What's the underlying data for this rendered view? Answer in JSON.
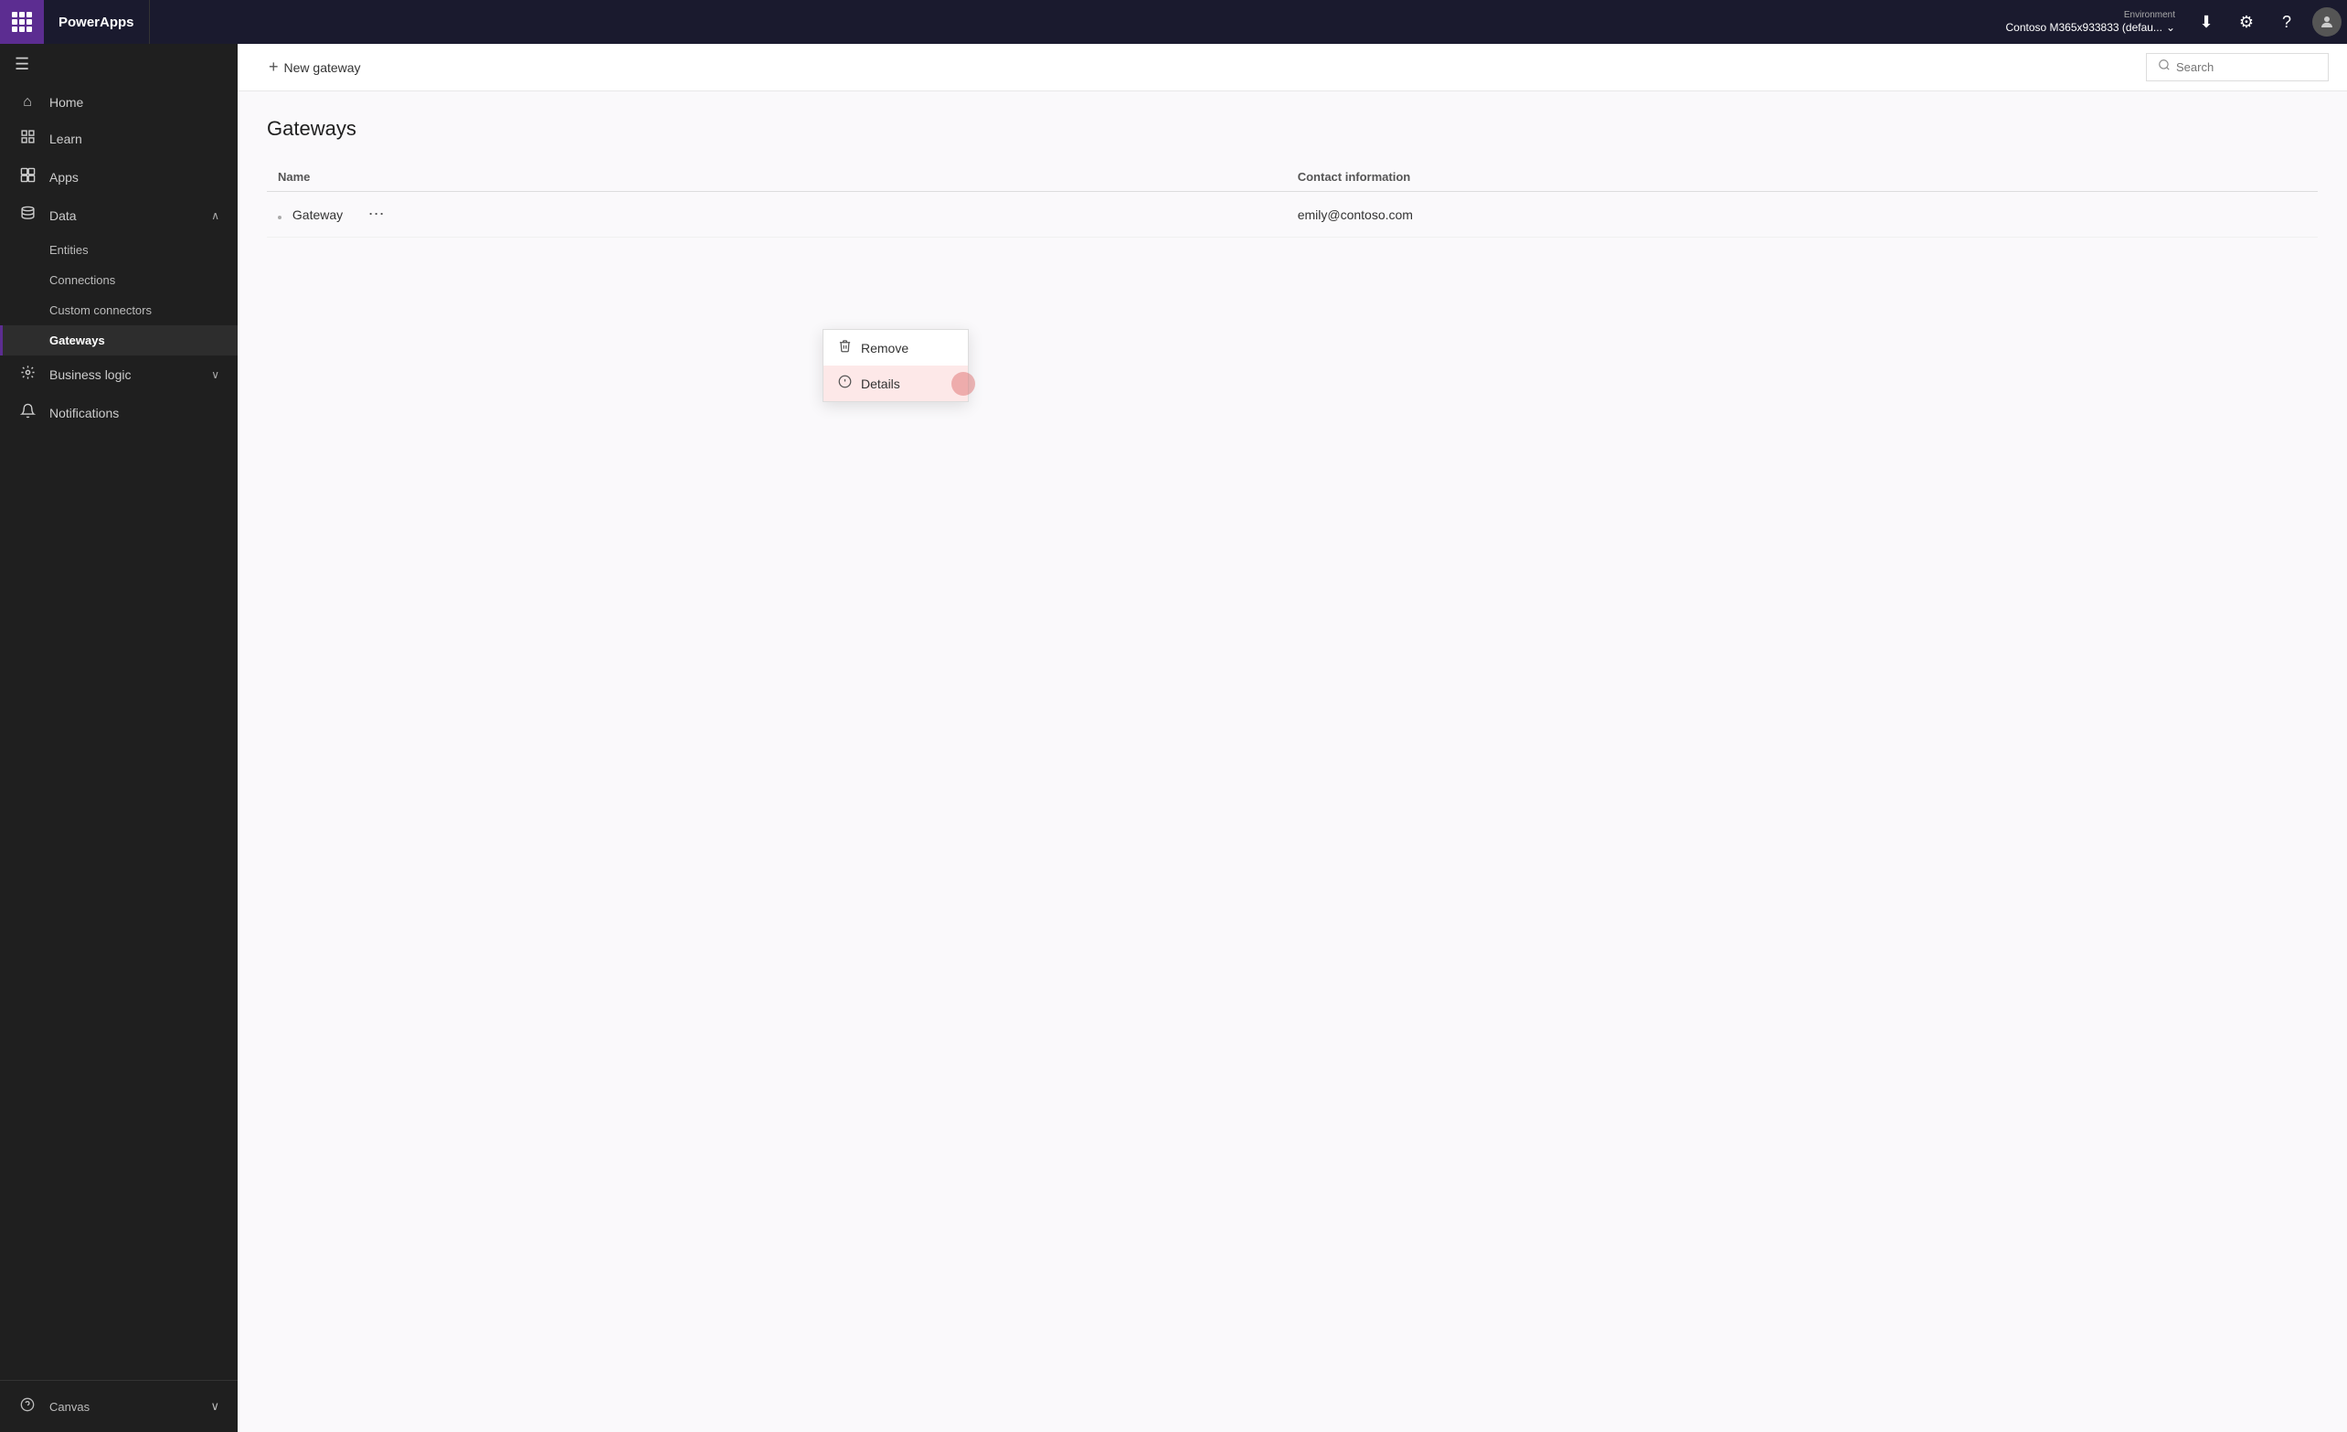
{
  "topbar": {
    "brand": "PowerApps",
    "environment_label": "Environment",
    "environment_name": "Contoso M365x933833 (defau...",
    "download_icon": "⬇",
    "settings_icon": "⚙",
    "help_icon": "?",
    "avatar_letter": ""
  },
  "sidebar": {
    "collapse_label": "☰",
    "items": [
      {
        "id": "home",
        "label": "Home",
        "icon": "⌂",
        "active": false
      },
      {
        "id": "learn",
        "label": "Learn",
        "icon": "📚",
        "active": false
      },
      {
        "id": "apps",
        "label": "Apps",
        "icon": "⊞",
        "active": false
      },
      {
        "id": "data",
        "label": "Data",
        "icon": "⊟",
        "active": false,
        "expanded": true
      },
      {
        "id": "entities",
        "label": "Entities",
        "icon": "",
        "sub": true
      },
      {
        "id": "connections",
        "label": "Connections",
        "icon": "",
        "sub": true
      },
      {
        "id": "custom-connectors",
        "label": "Custom connectors",
        "icon": "",
        "sub": true
      },
      {
        "id": "gateways",
        "label": "Gateways",
        "icon": "",
        "sub": true,
        "active": true
      },
      {
        "id": "business-logic",
        "label": "Business logic",
        "icon": "↗",
        "active": false,
        "expanded": false
      },
      {
        "id": "notifications",
        "label": "Notifications",
        "icon": "🔔",
        "active": false
      }
    ],
    "bottom": [
      {
        "id": "canvas",
        "label": "Canvas",
        "icon": "?"
      }
    ]
  },
  "toolbar": {
    "new_gateway_label": "New gateway",
    "plus_icon": "+"
  },
  "search": {
    "placeholder": "Search",
    "icon": "🔍"
  },
  "page": {
    "title": "Gateways"
  },
  "table": {
    "columns": [
      "Name",
      "Contact information"
    ],
    "rows": [
      {
        "name": "Gateway",
        "contact": "emily@contoso.com"
      }
    ]
  },
  "dropdown": {
    "items": [
      {
        "id": "remove",
        "label": "Remove",
        "icon": "🗑"
      },
      {
        "id": "details",
        "label": "Details",
        "icon": "ℹ",
        "hovered": true
      }
    ]
  }
}
